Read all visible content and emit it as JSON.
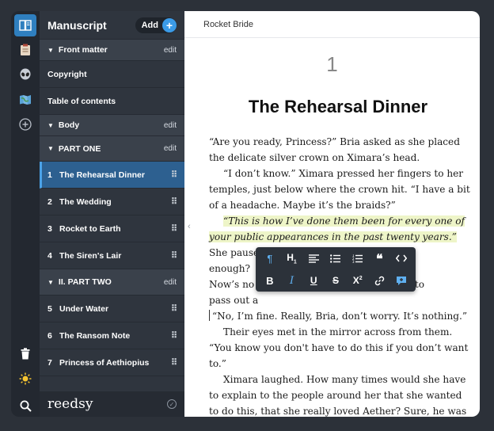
{
  "sidebar": {
    "title": "Manuscript",
    "add_label": "Add",
    "sections": [
      {
        "label": "Front matter",
        "edit": "edit"
      },
      {
        "label": "Body",
        "edit": "edit"
      },
      {
        "label": "PART ONE",
        "edit": "edit"
      },
      {
        "label": "II. PART TWO",
        "edit": "edit"
      }
    ],
    "front_items": [
      "Copyright",
      "Table of contents"
    ],
    "part_one": [
      {
        "num": "1",
        "label": "The Rehearsal Dinner"
      },
      {
        "num": "2",
        "label": "The Wedding"
      },
      {
        "num": "3",
        "label": "Rocket to Earth"
      },
      {
        "num": "4",
        "label": "The Siren's Lair"
      }
    ],
    "part_two": [
      {
        "num": "5",
        "label": "Under Water"
      },
      {
        "num": "6",
        "label": "The Ransom Note"
      },
      {
        "num": "7",
        "label": "Princess of Aethiopius"
      }
    ],
    "logo": "reedsy"
  },
  "editor": {
    "book_title": "Rocket Bride",
    "chapter_number": "1",
    "chapter_title": "The Rehearsal Dinner",
    "p1": "“Are you ready, Princess?” Bria asked as she placed the delicate silver crown on Ximara’s head.",
    "p2": "“I don’t know.” Ximara pressed her fingers to her temples, just below where the crown hit. “I have a bit of a headache. Maybe it’s the braids?”",
    "p3_highlight": "“This is how I’ve done them been for every one of your public appearances in the past twenty years.”",
    "p3_rest": " She paused, patting Xi",
    "p3_frag2": "enough?",
    "p3_frag3": "Now’s no",
    "p3_frag4": "t to",
    "p3_frag5": "pass out a",
    "p4": "“No, I’m fine. Really, Bria, don’t worry. It’s nothing.”",
    "p5": "Their eyes met in the mirror across from them. “You know you don't have to do this if you don’t want to.”",
    "p6": "Ximara laughed. How many times would she have to explain to the people around her that she wanted to do this, that she really loved Aether? Sure, he was the richest man in Aethiopius IV, and sure, she wanted a"
  },
  "toolbar": {
    "row1": [
      "paragraph-icon",
      "heading-icon",
      "align-left-icon",
      "bullet-list-icon",
      "numbered-list-icon",
      "quote-icon",
      "code-icon"
    ],
    "row2": [
      "bold-icon",
      "italic-icon",
      "underline-icon",
      "strikethrough-icon",
      "superscript-icon",
      "link-icon",
      "comment-icon"
    ]
  },
  "rail": [
    "book-icon",
    "notes-icon",
    "alien-icon",
    "map-icon",
    "add-icon",
    "trash-icon",
    "sun-icon",
    "search-icon"
  ],
  "colors": {
    "accent": "#2f7fbf",
    "highlight": "#eef5c8",
    "sidebar": "#2f353e"
  }
}
